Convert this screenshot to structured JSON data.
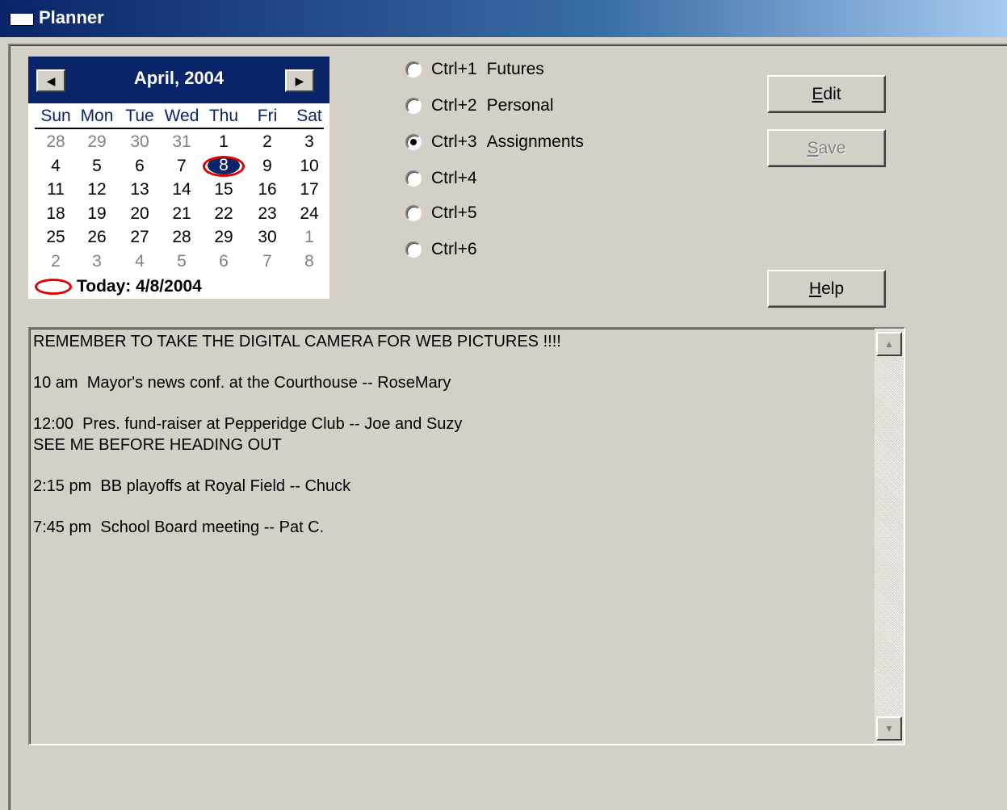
{
  "window": {
    "title": "Planner"
  },
  "calendar": {
    "month_label": "April, 2004",
    "prev_icon": "◀",
    "next_icon": "▶",
    "days_of_week": [
      "Sun",
      "Mon",
      "Tue",
      "Wed",
      "Thu",
      "Fri",
      "Sat"
    ],
    "weeks": [
      [
        "28",
        "29",
        "30",
        "31",
        "1",
        "2",
        "3"
      ],
      [
        "4",
        "5",
        "6",
        "7",
        "8",
        "9",
        "10"
      ],
      [
        "11",
        "12",
        "13",
        "14",
        "15",
        "16",
        "17"
      ],
      [
        "18",
        "19",
        "20",
        "21",
        "22",
        "23",
        "24"
      ],
      [
        "25",
        "26",
        "27",
        "28",
        "29",
        "30",
        "1"
      ],
      [
        "2",
        "3",
        "4",
        "5",
        "6",
        "7",
        "8"
      ]
    ],
    "selected_day": "8",
    "today_label": "Today: 4/8/2004",
    "colors": {
      "header": "#0a246a",
      "today_ring": "#e00000",
      "other_month": "#808080"
    }
  },
  "radios": [
    {
      "key": "Ctrl+1",
      "label": "Futures",
      "checked": false
    },
    {
      "key": "Ctrl+2",
      "label": "Personal",
      "checked": false
    },
    {
      "key": "Ctrl+3",
      "label": "Assignments",
      "checked": true
    },
    {
      "key": "Ctrl+4",
      "label": "",
      "checked": false
    },
    {
      "key": "Ctrl+5",
      "label": "",
      "checked": false
    },
    {
      "key": "Ctrl+6",
      "label": "",
      "checked": false
    }
  ],
  "buttons": {
    "edit": {
      "mnemonic": "E",
      "rest": "dit",
      "enabled": true
    },
    "save": {
      "mnemonic": "S",
      "rest": "ave",
      "enabled": false
    },
    "help": {
      "mnemonic": "H",
      "rest": "elp",
      "enabled": true
    }
  },
  "notes": {
    "text": "REMEMBER TO TAKE THE DIGITAL CAMERA FOR WEB PICTURES !!!!\n\n10 am  Mayor's news conf. at the Courthouse -- RoseMary\n\n12:00  Pres. fund-raiser at Pepperidge Club -- Joe and Suzy\nSEE ME BEFORE HEADING OUT\n\n2:15 pm  BB playoffs at Royal Field -- Chuck\n\n7:45 pm  School Board meeting -- Pat C.",
    "scroll_up_icon": "▲",
    "scroll_down_icon": "▼"
  }
}
